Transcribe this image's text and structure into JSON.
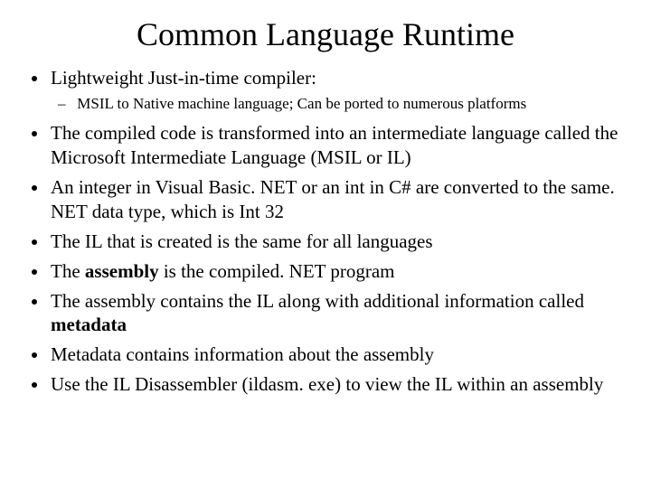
{
  "title": "Common Language Runtime",
  "bullets": {
    "b0": "Lightweight Just-in-time compiler:",
    "b0_sub0": "MSIL to Native machine language; Can be ported to numerous platforms",
    "b1": "The compiled code is transformed into an intermediate language called the Microsoft Intermediate Language (MSIL or IL)",
    "b2": "An integer in Visual Basic. NET or an int in C# are converted to the same. NET data type, which is Int 32",
    "b3": "The IL that is created is the same for all languages",
    "b4_pre": "The ",
    "b4_bold": "assembly",
    "b4_post": " is the compiled. NET program",
    "b5_pre": "The assembly contains the IL along with additional information called ",
    "b5_bold": "metadata",
    "b6": "Metadata contains information about the assembly",
    "b7": "Use the IL Disassembler (ildasm. exe) to view the IL within an assembly"
  }
}
